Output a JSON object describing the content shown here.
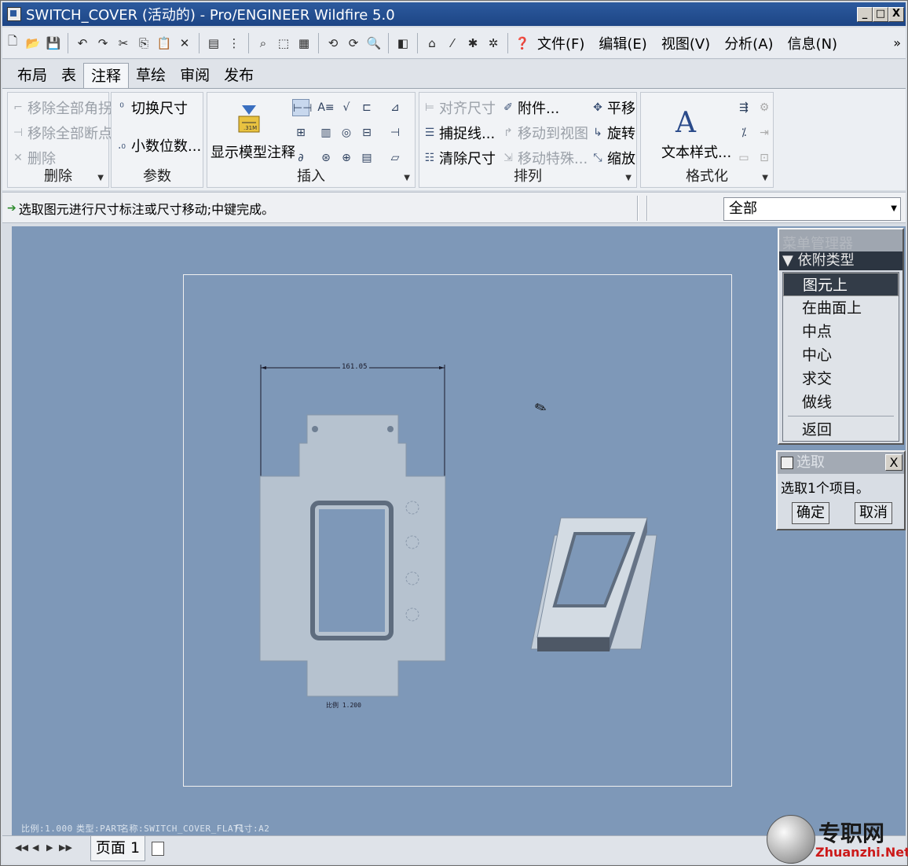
{
  "window": {
    "title": "SWITCH_COVER (活动的) - Pro/ENGINEER Wildfire 5.0",
    "controls": {
      "minimize": "_",
      "maximize": "□",
      "close": "X"
    }
  },
  "toolbar": {
    "menus": [
      "文件(F)",
      "编辑(E)",
      "视图(V)",
      "分析(A)",
      "信息(N)"
    ],
    "overflow": "»"
  },
  "tabs": [
    {
      "label": "布局"
    },
    {
      "label": "表"
    },
    {
      "label": "注释",
      "active": true
    },
    {
      "label": "草绘"
    },
    {
      "label": "审阅"
    },
    {
      "label": "发布"
    }
  ],
  "ribbon": {
    "delete_group": {
      "title": "删除",
      "remove_all_jogs": "移除全部角拐",
      "remove_all_breaks": "移除全部断点",
      "delete": "删除"
    },
    "params_group": {
      "title": "参数",
      "toggle_dims": "切换尺寸",
      "decimal_places": "小数位数..."
    },
    "insert_group": {
      "title": "插入",
      "show_model_annotations": "显示模型注释"
    },
    "arrange_group": {
      "title": "排列",
      "align_dims": "对齐尺寸",
      "snap_lines": "捕捉线...",
      "cleanup_dims": "清除尺寸",
      "attach": "附件...",
      "move_to_view": "移动到视图",
      "move_special": "移动特殊...",
      "translate": "平移",
      "rotate": "旋转",
      "scale": "缩放"
    },
    "format_group": {
      "title": "格式化",
      "text_style": "文本样式..."
    }
  },
  "message": {
    "text": "选取图元进行尺寸标注或尺寸移动;中键完成。",
    "filter_value": "全部"
  },
  "drawing": {
    "dimension": "161.05",
    "flat_note": "比例 1.200",
    "footer": {
      "scale": "比例:1.000",
      "type": "类型:PART",
      "name": "名称:SWITCH_COVER_FLAT1",
      "size": "尺寸:A2"
    }
  },
  "menu_manager": {
    "title": "菜单管理器",
    "category": "依附类型",
    "items": [
      "图元上",
      "在曲面上",
      "中点",
      "中心",
      "求交",
      "做线"
    ],
    "selected_index": 0,
    "back": "返回"
  },
  "select_dialog": {
    "title": "选取",
    "message": "选取1个项目。",
    "ok": "确定",
    "cancel": "取消",
    "close": "X"
  },
  "statusbar": {
    "page_tab": "页面 1"
  },
  "watermark": {
    "cn": "专职网",
    "en": "Zhuanzhi.Net"
  }
}
